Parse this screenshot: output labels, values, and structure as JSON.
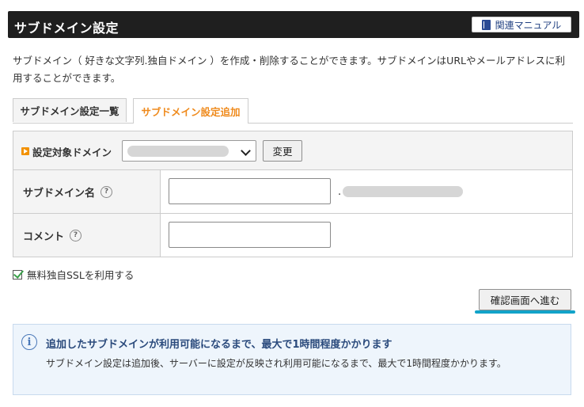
{
  "header": {
    "title": "サブドメイン設定",
    "manual_button": "関連マニュアル",
    "manual_icon": "book-icon"
  },
  "description": "サブドメイン（ 好きな文字列.独自ドメイン ）を作成・削除することができます。サブドメインはURLやメールアドレスに利用することができます。",
  "tabs": [
    {
      "label": "サブドメイン設定一覧",
      "active": false
    },
    {
      "label": "サブドメイン設定追加",
      "active": true
    }
  ],
  "form": {
    "domain_label": "設定対象ドメイン",
    "change_button": "変更",
    "subdomain_label": "サブドメイン名",
    "subdomain_value": "",
    "suffix_dot": ".",
    "comment_label": "コメント",
    "comment_value": "",
    "help_glyph": "?"
  },
  "ssl": {
    "label": "無料独自SSLを利用する",
    "checked": true
  },
  "confirm_button": "確認画面へ進む",
  "notice": {
    "icon_glyph": "i",
    "title": "追加したサブドメインが利用可能になるまで、最大で1時間程度かかります",
    "body": "サブドメイン設定は追加後、サーバーに設定が反映され利用可能になるまで、最大で1時間程度かかります。"
  },
  "colors": {
    "header_bg": "#1f1f1f",
    "active_tab": "#ef8a1c",
    "highlight_underline": "#12a3c9",
    "notice_title": "#2a4a7c"
  }
}
